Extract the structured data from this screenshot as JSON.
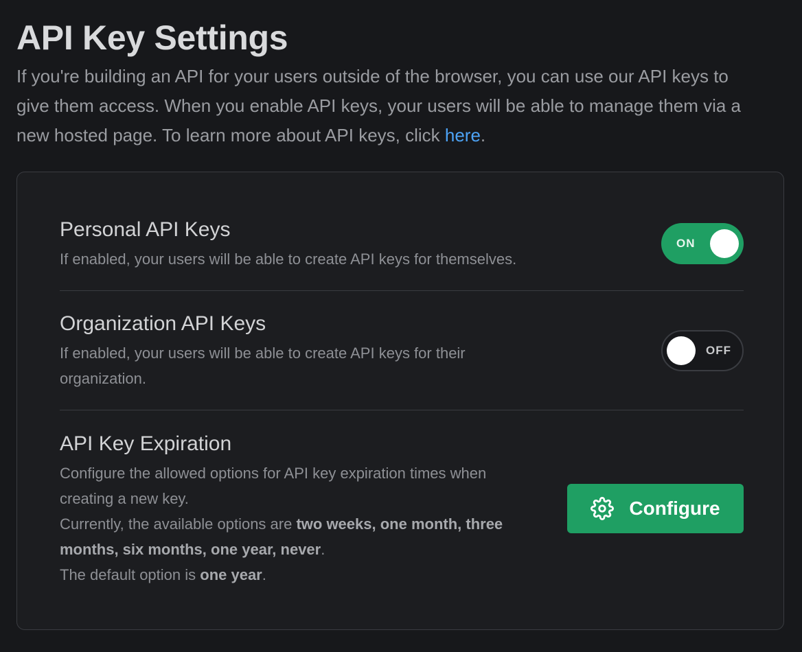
{
  "header": {
    "title": "API Key Settings",
    "intro_text": "If you're building an API for your users outside of the browser, you can use our API keys to give them access. When you enable API keys, your users will be able to manage them via a new hosted page. To learn more about API keys, click ",
    "intro_link": "here",
    "intro_end": "."
  },
  "settings": {
    "personal": {
      "title": "Personal API Keys",
      "description": "If enabled, your users will be able to create API keys for themselves.",
      "toggle_label": "ON",
      "enabled": true
    },
    "organization": {
      "title": "Organization API Keys",
      "description": "If enabled, your users will be able to create API keys for their organization.",
      "toggle_label": "OFF",
      "enabled": false
    },
    "expiration": {
      "title": "API Key Expiration",
      "description": "Configure the allowed options for API key expiration times when creating a new key.",
      "options_prefix": "Currently, the available options are ",
      "options": "two weeks, one month, three months, six months, one year, never",
      "options_suffix": ".",
      "default_prefix": "The default option is ",
      "default_value": "one year",
      "default_suffix": ".",
      "button_label": "Configure",
      "button_icon": "gear-icon"
    }
  },
  "colors": {
    "accent": "#1f9f63",
    "link": "#4da3f5",
    "background": "#17181b"
  }
}
